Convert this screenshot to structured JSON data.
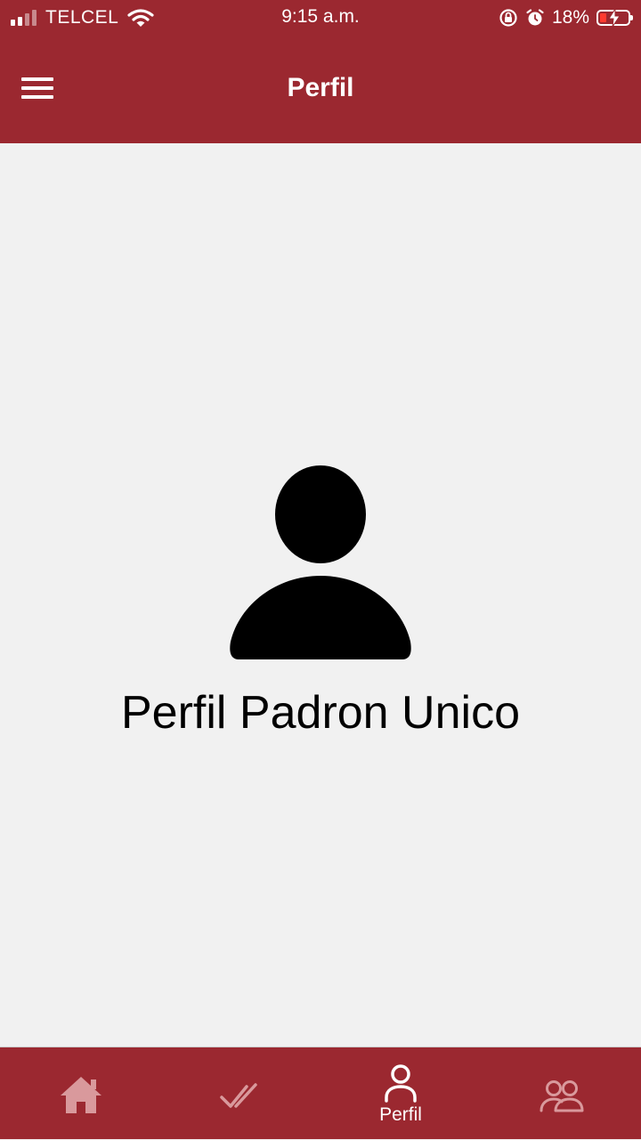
{
  "status_bar": {
    "carrier": "TELCEL",
    "time": "9:15 a.m.",
    "battery_percent": "18%",
    "icons": [
      "signal-icon",
      "wifi-icon",
      "orientation-lock-icon",
      "alarm-icon",
      "battery-charging-icon"
    ]
  },
  "header": {
    "title": "Perfil",
    "menu_icon": "hamburger-menu-icon"
  },
  "main": {
    "avatar_icon": "person-icon",
    "profile_name": "Perfil Padron Unico"
  },
  "tabs": [
    {
      "icon": "home-icon",
      "label": "",
      "active": false
    },
    {
      "icon": "double-check-icon",
      "label": "",
      "active": false
    },
    {
      "icon": "person-outline-icon",
      "label": "Perfil",
      "active": true
    },
    {
      "icon": "people-icon",
      "label": "",
      "active": false
    }
  ],
  "colors": {
    "primary": "#9b2830",
    "background": "#f1f1f1",
    "inactive_tab_icon": "#d9999c",
    "active_tab_icon": "#ffffff",
    "battery_low": "#ff3b30"
  }
}
